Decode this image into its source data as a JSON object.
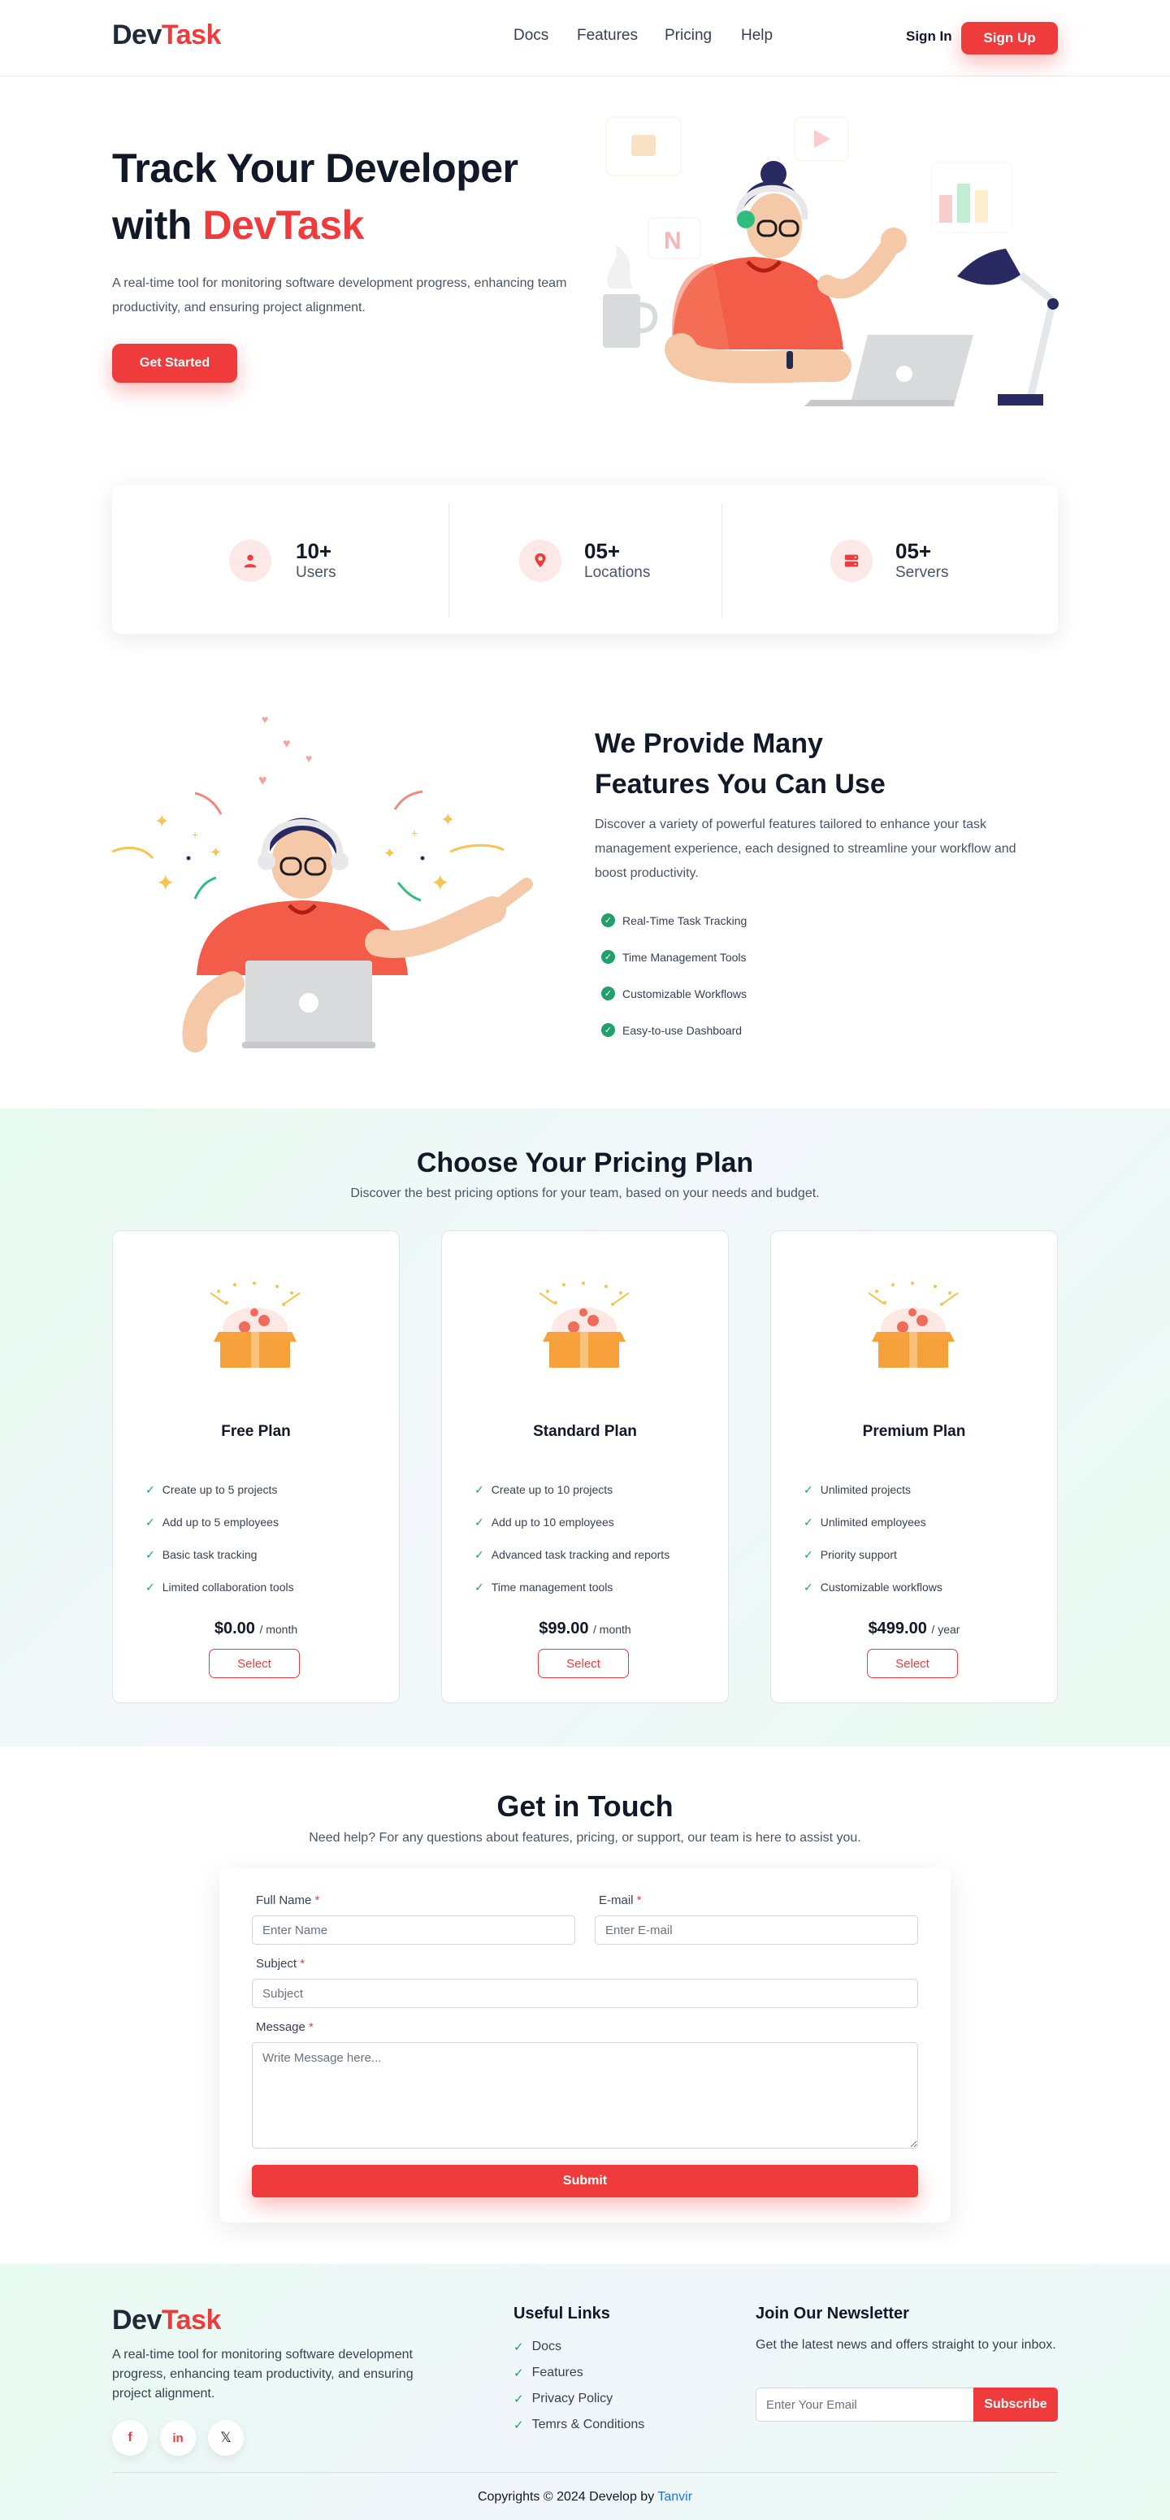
{
  "brand": {
    "part1": "Dev",
    "part2": "Task"
  },
  "nav": {
    "items": [
      "Docs",
      "Features",
      "Pricing",
      "Help"
    ],
    "sign_in": "Sign In",
    "sign_up": "Sign Up"
  },
  "hero": {
    "title_line1": "Track Your Developer",
    "title_line2_prefix": "with ",
    "title_line2_accent": "DevTask",
    "description": "A real-time tool for monitoring software development progress, enhancing team productivity, and ensuring project alignment.",
    "cta": "Get Started"
  },
  "stats": [
    {
      "icon": "user-icon",
      "value": "10+",
      "label": "Users"
    },
    {
      "icon": "location-pin-icon",
      "value": "05+",
      "label": "Locations"
    },
    {
      "icon": "server-icon",
      "value": "05+",
      "label": "Servers"
    }
  ],
  "features": {
    "title_line1": "We Provide Many",
    "title_line2": "Features You Can Use",
    "description": "Discover a variety of powerful features tailored to enhance your task management experience, each designed to streamline your workflow and boost productivity.",
    "items": [
      "Real-Time Task Tracking",
      "Time Management Tools",
      "Customizable Workflows",
      "Easy-to-use Dashboard"
    ]
  },
  "pricing": {
    "title": "Choose Your Pricing Plan",
    "subtitle": "Discover the best pricing options for your team, based on your needs and budget.",
    "plans": [
      {
        "name": "Free Plan",
        "features": [
          "Create up to 5 projects",
          "Add up to 5 employees",
          "Basic task tracking",
          "Limited collaboration tools"
        ],
        "price": "$0.00",
        "period": "/ month",
        "button": "Select"
      },
      {
        "name": "Standard Plan",
        "features": [
          "Create up to 10 projects",
          "Add up to 10 employees",
          "Advanced task tracking and reports",
          "Time management tools"
        ],
        "price": "$99.00",
        "period": "/ month",
        "button": "Select"
      },
      {
        "name": "Premium Plan",
        "features": [
          "Unlimited projects",
          "Unlimited employees",
          "Priority support",
          "Customizable workflows"
        ],
        "price": "$499.00",
        "period": "/ year",
        "button": "Select"
      }
    ]
  },
  "contact": {
    "title": "Get in Touch",
    "subtitle": "Need help? For any questions about features, pricing, or support, our team is here to assist you.",
    "fields": {
      "name_label": "Full Name",
      "name_placeholder": "Enter Name",
      "email_label": "E-mail",
      "email_placeholder": "Enter E-mail",
      "subject_label": "Subject",
      "subject_placeholder": "Subject",
      "message_label": "Message",
      "message_placeholder": "Write Message here..."
    },
    "required_mark": "*",
    "submit": "Submit"
  },
  "footer": {
    "description": "A real-time tool for monitoring software development progress, enhancing team productivity, and ensuring project alignment.",
    "socials": [
      "facebook-icon",
      "linkedin-icon",
      "x-icon"
    ],
    "useful_links_title": "Useful Links",
    "useful_links": [
      "Docs",
      "Features",
      "Privacy Policy",
      "Temrs & Conditions"
    ],
    "newsletter_title": "Join Our Newsletter",
    "newsletter_text": "Get the latest news and offers straight to your inbox.",
    "newsletter_placeholder": "Enter Your Email",
    "subscribe": "Subscribe",
    "copyright_prefix": "Copyrights © 2024 Develop by ",
    "copyright_author": "Tanvir"
  },
  "colors": {
    "accent": "#ef3b3b",
    "success": "#22a06b",
    "dark": "#111827",
    "author_link": "#1f6feb"
  }
}
